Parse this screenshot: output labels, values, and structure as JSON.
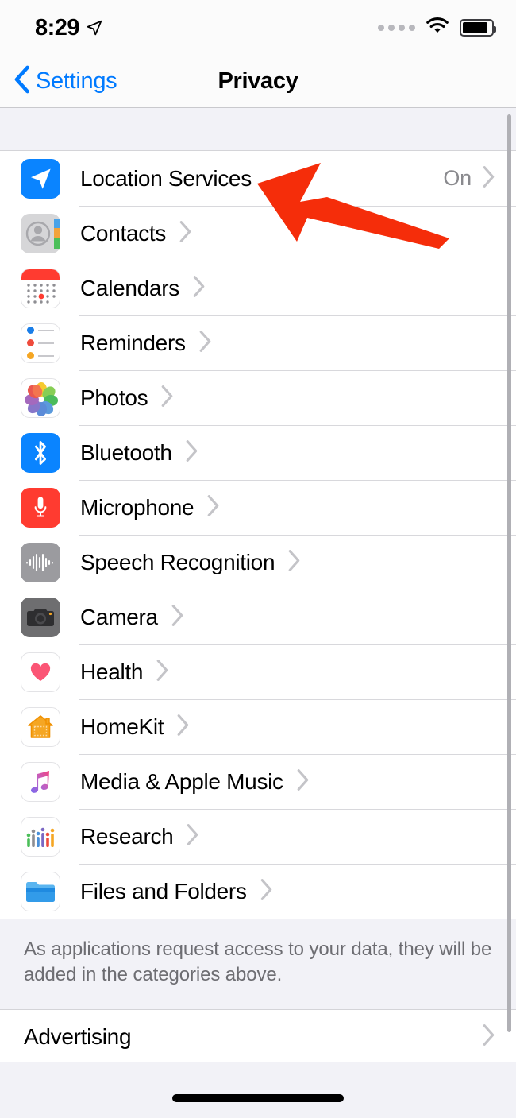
{
  "status_bar": {
    "time": "8:29",
    "location_icon": "location-arrow-icon",
    "cellular_icon": "cellular-dots-icon",
    "wifi_icon": "wifi-icon",
    "battery_icon": "battery-icon"
  },
  "nav": {
    "back_label": "Settings",
    "back_icon": "chevron-left-icon",
    "title": "Privacy"
  },
  "colors": {
    "accent_blue": "#007aff",
    "icon_blue": "#0a84ff",
    "red": "#ff3b30",
    "annotation_red": "#f52d0a",
    "value_gray": "#8a8a8e",
    "group_bg": "#f2f2f7"
  },
  "list": {
    "rows": [
      {
        "label": "Location Services",
        "value": "On",
        "icon": "location-services-icon"
      },
      {
        "label": "Contacts",
        "value": "",
        "icon": "contacts-icon"
      },
      {
        "label": "Calendars",
        "value": "",
        "icon": "calendars-icon"
      },
      {
        "label": "Reminders",
        "value": "",
        "icon": "reminders-icon"
      },
      {
        "label": "Photos",
        "value": "",
        "icon": "photos-icon"
      },
      {
        "label": "Bluetooth",
        "value": "",
        "icon": "bluetooth-icon"
      },
      {
        "label": "Microphone",
        "value": "",
        "icon": "microphone-icon"
      },
      {
        "label": "Speech Recognition",
        "value": "",
        "icon": "speech-recognition-icon"
      },
      {
        "label": "Camera",
        "value": "",
        "icon": "camera-icon"
      },
      {
        "label": "Health",
        "value": "",
        "icon": "health-icon"
      },
      {
        "label": "HomeKit",
        "value": "",
        "icon": "homekit-icon"
      },
      {
        "label": "Media & Apple Music",
        "value": "",
        "icon": "media-apple-music-icon"
      },
      {
        "label": "Research",
        "value": "",
        "icon": "research-icon"
      },
      {
        "label": "Files and Folders",
        "value": "",
        "icon": "files-and-folders-icon"
      }
    ]
  },
  "footer_note": "As applications request access to your data, they will be added in the categories above.",
  "advertising": {
    "label": "Advertising"
  },
  "annotation": {
    "type": "red-arrow",
    "points_at": "Location Services",
    "color": "#f52d0a"
  }
}
